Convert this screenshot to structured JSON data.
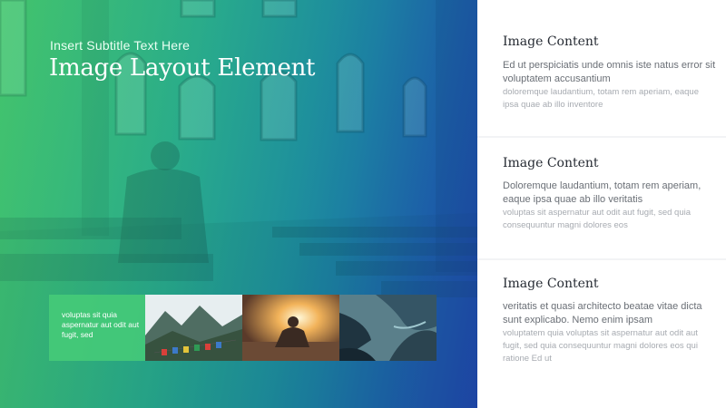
{
  "hero": {
    "subtitle": "Insert Subtitle Text Here",
    "title": "Image Layout Element",
    "caption": "voluptas sit quia aspernatur aut odit aut fugit, sed"
  },
  "cards": [
    {
      "heading": "Image Content",
      "bold": "Ed ut perspiciatis unde omnis iste natus error sit voluptatem accusantium",
      "light": "doloremque laudantium, totam rem aperiam, eaque ipsa quae ab illo inventore"
    },
    {
      "heading": "Image Content",
      "bold": "Doloremque laudantium, totam rem aperiam, eaque ipsa quae ab illo veritatis",
      "light": "voluptas sit aspernatur aut odit aut fugit, sed quia consequuntur magni dolores eos"
    },
    {
      "heading": "Image Content",
      "bold": "veritatis et quasi architecto beatae vitae dicta sunt explicabo. Nemo enim ipsam",
      "light": "voluptatem quia voluptas sit aspernatur aut odit aut fugit, sed quia consequuntur magni dolores eos qui ratione Ed ut"
    }
  ],
  "colors": {
    "accent_green": "#46cd78",
    "accent_blue": "#1f45a4",
    "heading_text": "#262b33",
    "body_text": "#6a6f76",
    "muted_text": "#a7abb1"
  }
}
